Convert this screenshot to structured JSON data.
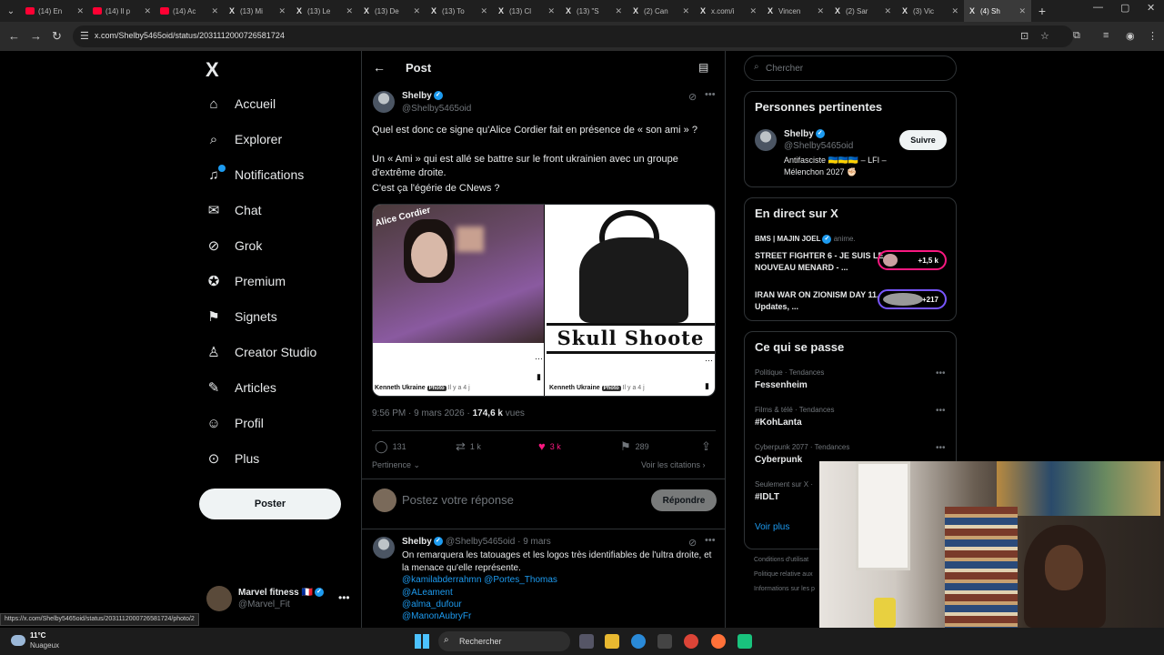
{
  "browser": {
    "tabs": [
      {
        "label": "(14) En",
        "icon": "youtube"
      },
      {
        "label": "(14) Il p",
        "icon": "youtube"
      },
      {
        "label": "(14) Ac",
        "icon": "youtube"
      },
      {
        "label": "(13) Mi",
        "icon": "x"
      },
      {
        "label": "(13) Le",
        "icon": "x"
      },
      {
        "label": "(13) De",
        "icon": "x"
      },
      {
        "label": "(13) To",
        "icon": "x"
      },
      {
        "label": "(13) Cl",
        "icon": "x"
      },
      {
        "label": "(13) \"S",
        "icon": "x"
      },
      {
        "label": "(2) Can",
        "icon": "x"
      },
      {
        "label": "x.com/i",
        "icon": "x"
      },
      {
        "label": "Vincen",
        "icon": "x"
      },
      {
        "label": "(2) Sar",
        "icon": "x"
      },
      {
        "label": "(3) Vic",
        "icon": "x"
      },
      {
        "label": "(4) Sh",
        "icon": "x"
      }
    ],
    "url": "x.com/Shelby5465oid/status/2031112000726581724",
    "status_url": "https://x.com/Shelby5465oid/status/2031112000726581724/photo/2"
  },
  "nav": {
    "items": [
      {
        "label": "Accueil",
        "icon": "home-icon",
        "glyph": "⌂"
      },
      {
        "label": "Explorer",
        "icon": "search-icon",
        "glyph": "⌕"
      },
      {
        "label": "Notifications",
        "icon": "bell-icon",
        "glyph": "♫"
      },
      {
        "label": "Chat",
        "icon": "mail-icon",
        "glyph": "✉"
      },
      {
        "label": "Grok",
        "icon": "grok-icon",
        "glyph": "⊘"
      },
      {
        "label": "Premium",
        "icon": "premium-icon",
        "glyph": "✪"
      },
      {
        "label": "Signets",
        "icon": "bookmark-icon",
        "glyph": "⚑"
      },
      {
        "label": "Creator Studio",
        "icon": "creator-icon",
        "glyph": "♙"
      },
      {
        "label": "Articles",
        "icon": "article-icon",
        "glyph": "✎"
      },
      {
        "label": "Profil",
        "icon": "profile-icon",
        "glyph": "☺"
      },
      {
        "label": "Plus",
        "icon": "more-icon",
        "glyph": "⊙"
      }
    ],
    "post_button": "Poster",
    "account": {
      "name": "Marvel fitness",
      "flag": "🇫🇷",
      "handle": "@Marvel_Fit"
    }
  },
  "post_header": {
    "title": "Post"
  },
  "post": {
    "author": "Shelby",
    "handle": "@Shelby5465oid",
    "line1": "Quel est donc ce signe qu'Alice Cordier fait en présence de « son ami » ?",
    "line2": "Un « Ami » qui est allé se battre sur le front ukrainien avec un groupe d'extrême droite.",
    "line3": "C'est ça l'égérie de CNews ?",
    "media_left_label": "Alice Cordier",
    "media_left_caption": "Kenneth Ukraine",
    "media_right_caption": "Kenneth Ukraine",
    "photo_tag": "Photo",
    "media_age": "Il y a 4 j",
    "skull_text": "Skull Shoote",
    "time": "9:56 PM · 9 mars 2026 · ",
    "views_count": "174,6 k",
    "views_label": " vues",
    "replies": "131",
    "reposts": "1 k",
    "likes": "3 k",
    "bookmarks": "289",
    "sort_label": "Pertinence",
    "citations_label": "Voir les citations"
  },
  "reply_box": {
    "placeholder": "Postez votre réponse",
    "button": "Répondre"
  },
  "reply": {
    "author": "Shelby",
    "handle_time": "@Shelby5465oid · 9 mars",
    "text": "On remarquera les tatouages et les logos très identifiables de l'ultra droite, et la menace qu'elle représente.",
    "mentions": [
      "@kamilabderrahmn @Portes_Thomas",
      "@ALeament",
      "@alma_dufour",
      "@ManonAubryFr"
    ]
  },
  "sidebar": {
    "search_placeholder": "Chercher",
    "relevant_title": "Personnes pertinentes",
    "relevant_person": {
      "name": "Shelby",
      "handle": "@Shelby5465oid",
      "bio": "Antifasciste 🇺🇦🇺🇦🇺🇦 – LFI – Mélenchon 2027 ✊🏻",
      "follow": "Suivre"
    },
    "live_title": "En direct sur X",
    "live_host": "BMS | MAJIN JOEL",
    "live_host_suffix": "anime.",
    "live_items": [
      {
        "title": "STREET FIGHTER 6 - JE SUIS LE NOUVEAU MENARD - ...",
        "count": "+1,5 k"
      },
      {
        "title": "IRAN WAR ON ZIONISM DAY 11, Updates, ...",
        "count": "+217"
      }
    ],
    "trends_title": "Ce qui se passe",
    "trends": [
      {
        "meta": "Politique · Tendances",
        "name": "Fessenheim"
      },
      {
        "meta": "Films & télé · Tendances",
        "name": "#KohLanta"
      },
      {
        "meta": "Cyberpunk 2077 · Tendances",
        "name": "Cyberpunk"
      },
      {
        "meta": "Seulement sur X · ",
        "name": "#IDLT"
      }
    ],
    "show_more": "Voir plus",
    "footer": [
      "Conditions d'utilisat",
      "Politique relative aux",
      "Informations sur les p"
    ]
  },
  "taskbar": {
    "temp": "11°C",
    "weather": "Nuageux",
    "search": "Rechercher"
  }
}
